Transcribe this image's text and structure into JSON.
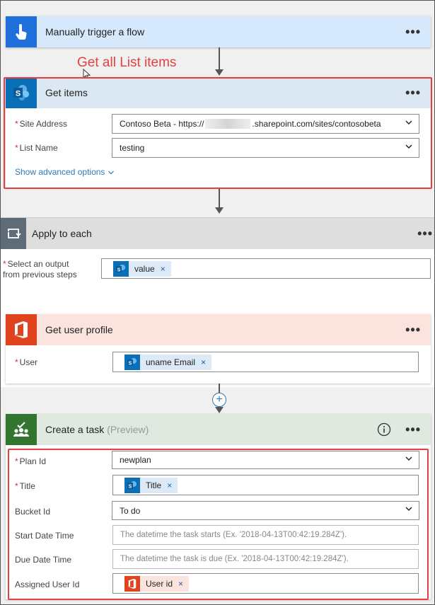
{
  "trigger": {
    "title": "Manually trigger a flow",
    "menu": "•••"
  },
  "annotation": "Get all List items",
  "get_items": {
    "title": "Get items",
    "menu": "•••",
    "site_label": "Site Address",
    "site_value_prefix": "Contoso Beta - https://",
    "site_value_suffix": ".sharepoint.com/sites/contosobeta",
    "list_label": "List Name",
    "list_value": "testing",
    "advanced_link": "Show advanced options"
  },
  "apply_each": {
    "title": "Apply to each",
    "menu": "•••",
    "output_label_line1": "Select an output",
    "output_label_line2": "from previous steps",
    "token": "value"
  },
  "user_profile": {
    "title": "Get user profile",
    "menu": "•••",
    "user_label": "User",
    "token": "uname Email"
  },
  "create_task": {
    "title": "Create a task",
    "preview": "(Preview)",
    "menu": "•••",
    "plan_label": "Plan Id",
    "plan_value": "newplan",
    "title_label": "Title",
    "title_token": "Title",
    "bucket_label": "Bucket Id",
    "bucket_value": "To do",
    "start_label": "Start Date Time",
    "start_placeholder": "The datetime the task starts (Ex. '2018-04-13T00:42:19.284Z').",
    "due_label": "Due Date Time",
    "due_placeholder": "The datetime the task is due (Ex. '2018-04-13T00:42:19.284Z').",
    "assigned_label": "Assigned User Id",
    "assigned_token": "User id"
  },
  "required_mark": "*",
  "token_remove": "×",
  "add_step": "+",
  "colors": {
    "trigger_header": "#d6e8fb",
    "trigger_icon": "#1e6fd9",
    "sharepoint_header": "#dbe7f3",
    "sharepoint_icon": "#0b6fb8",
    "loop_header": "#dedede",
    "loop_icon": "#5e6b78",
    "office_header": "#fbe3de",
    "office_icon": "#e0431e",
    "planner_header": "#dfe9df",
    "planner_icon": "#31752f",
    "annotation": "#e53f3f"
  },
  "icons": [
    "touch-icon",
    "sharepoint-icon",
    "loop-icon",
    "office-icon",
    "planner-icon",
    "info-icon",
    "chevron-down-icon",
    "plus-icon"
  ]
}
